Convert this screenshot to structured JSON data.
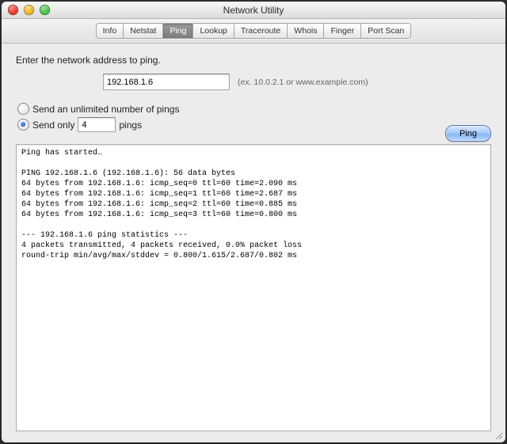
{
  "window": {
    "title": "Network Utility"
  },
  "tabs": [
    {
      "label": "Info"
    },
    {
      "label": "Netstat"
    },
    {
      "label": "Ping"
    },
    {
      "label": "Lookup"
    },
    {
      "label": "Traceroute"
    },
    {
      "label": "Whois"
    },
    {
      "label": "Finger"
    },
    {
      "label": "Port Scan"
    }
  ],
  "active_tab": "Ping",
  "form": {
    "prompt": "Enter the network address to ping.",
    "address_value": "192.168.1.6",
    "address_hint": "(ex. 10.0.2.1 or www.example.com)",
    "unlimited_label": "Send an unlimited number of pings",
    "sendonly_prefix": "Send only",
    "sendonly_suffix": "pings",
    "count_value": "4",
    "selected": "sendonly"
  },
  "actions": {
    "ping_label": "Ping"
  },
  "output": "Ping has started…\n\nPING 192.168.1.6 (192.168.1.6): 56 data bytes\n64 bytes from 192.168.1.6: icmp_seq=0 ttl=60 time=2.090 ms\n64 bytes from 192.168.1.6: icmp_seq=1 ttl=60 time=2.687 ms\n64 bytes from 192.168.1.6: icmp_seq=2 ttl=60 time=0.885 ms\n64 bytes from 192.168.1.6: icmp_seq=3 ttl=60 time=0.800 ms\n\n--- 192.168.1.6 ping statistics ---\n4 packets transmitted, 4 packets received, 0.0% packet loss\nround-trip min/avg/max/stddev = 0.800/1.615/2.687/0.802 ms"
}
